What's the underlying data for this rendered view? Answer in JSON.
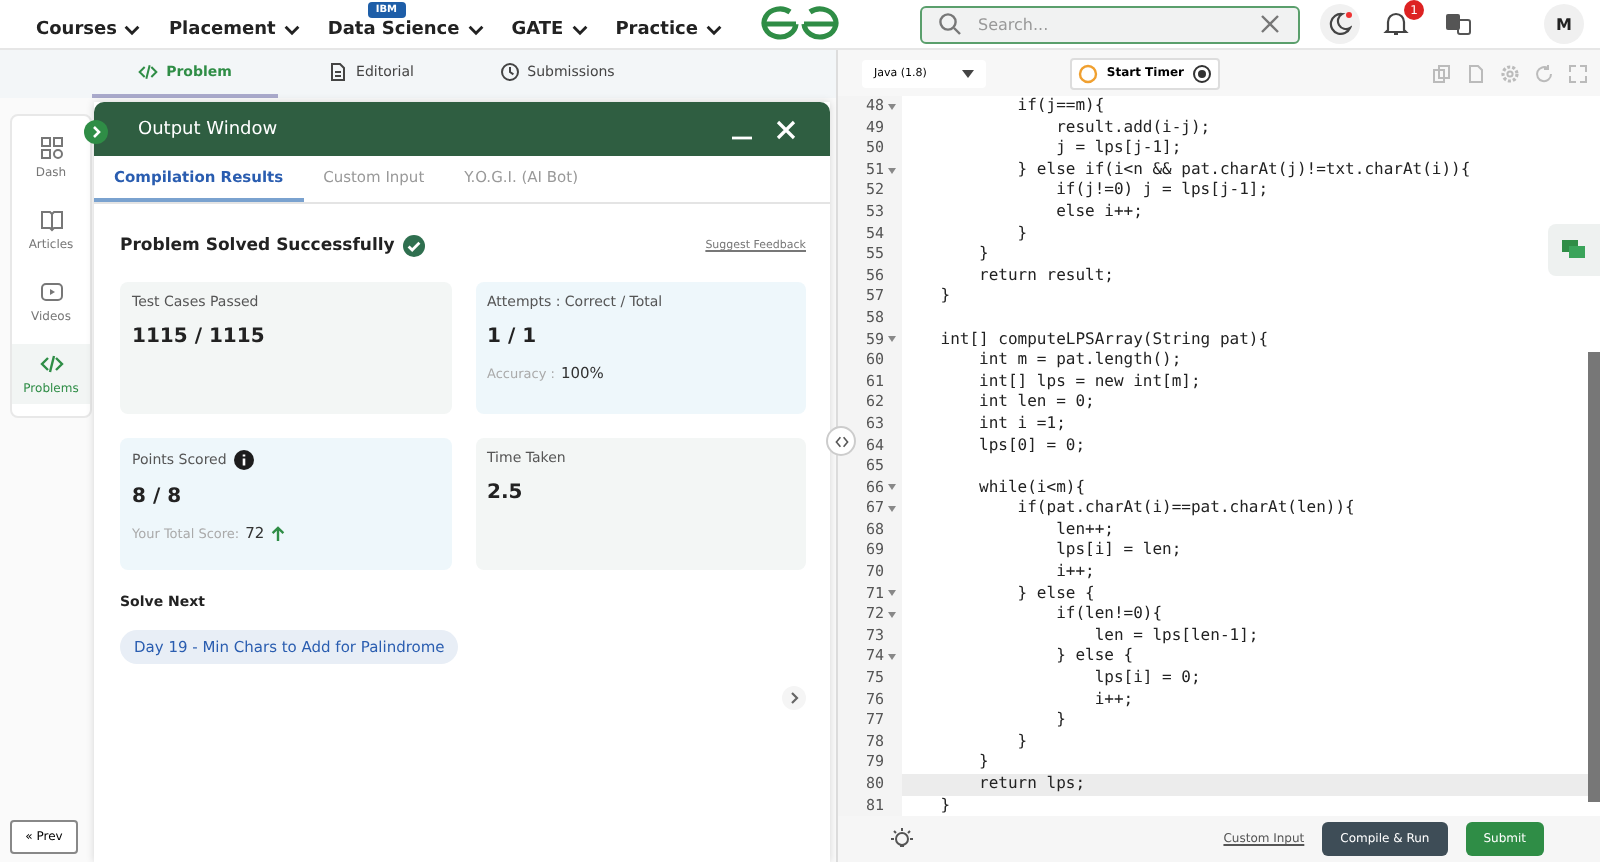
{
  "nav": {
    "items": [
      {
        "label": "Courses"
      },
      {
        "label": "Placement"
      },
      {
        "label": "Data Science",
        "badge": "IBM"
      },
      {
        "label": "GATE"
      },
      {
        "label": "Practice"
      }
    ],
    "search": {
      "placeholder": "Search..."
    },
    "notification_count": "1",
    "avatar_initial": "M"
  },
  "problem_tabs": [
    {
      "label": "Problem",
      "selected": true
    },
    {
      "label": "Editorial",
      "selected": false
    },
    {
      "label": "Submissions",
      "selected": false
    }
  ],
  "sidebar": {
    "items": [
      {
        "label": "Dash",
        "selected": false
      },
      {
        "label": "Articles",
        "selected": false
      },
      {
        "label": "Videos",
        "selected": false
      },
      {
        "label": "Problems",
        "selected": true
      }
    ],
    "prev_button": "« Prev"
  },
  "output_window": {
    "title": "Output Window",
    "tabs": [
      {
        "label": "Compilation Results",
        "selected": true
      },
      {
        "label": "Custom Input",
        "selected": false
      },
      {
        "label": "Y.O.G.I. (AI Bot)",
        "selected": false
      }
    ],
    "status": "Problem Solved Successfully",
    "feedback_link": "Suggest Feedback",
    "cards": [
      {
        "label": "Test Cases Passed",
        "value": "1115 / 1115"
      },
      {
        "label": "Attempts : Correct / Total",
        "value": "1 / 1",
        "note_label": "Accuracy :",
        "note_value": "100%"
      },
      {
        "label": "Points Scored",
        "value": "8 / 8",
        "info": true,
        "note_label": "Your Total Score:",
        "note_value": "72",
        "trend_up": true
      },
      {
        "label": "Time Taken",
        "value": "2.5"
      }
    ],
    "solve_next": {
      "heading": "Solve Next",
      "items": [
        "Day 19 - Min Chars to Add for Palindrome"
      ]
    }
  },
  "editor": {
    "language": "Java (1.8)",
    "timer_button": "Start Timer",
    "lines": [
      {
        "number": "48",
        "text": "            if(j==m){",
        "fold": true,
        "current": false
      },
      {
        "number": "49",
        "text": "                result.add(i-j);",
        "fold": false,
        "current": false
      },
      {
        "number": "50",
        "text": "                j = lps[j-1];",
        "fold": false,
        "current": false
      },
      {
        "number": "51",
        "text": "            } else if(i<n && pat.charAt(j)!=txt.charAt(i)){",
        "fold": true,
        "current": false
      },
      {
        "number": "52",
        "text": "                if(j!=0) j = lps[j-1];",
        "fold": false,
        "current": false
      },
      {
        "number": "53",
        "text": "                else i++;",
        "fold": false,
        "current": false
      },
      {
        "number": "54",
        "text": "            }",
        "fold": false,
        "current": false
      },
      {
        "number": "55",
        "text": "        }",
        "fold": false,
        "current": false
      },
      {
        "number": "56",
        "text": "        return result;",
        "fold": false,
        "current": false
      },
      {
        "number": "57",
        "text": "    }",
        "fold": false,
        "current": false
      },
      {
        "number": "58",
        "fold": false,
        "current": false
      },
      {
        "number": "59",
        "text": "    int[] computeLPSArray(String pat){",
        "fold": true,
        "current": false
      },
      {
        "number": "60",
        "text": "        int m = pat.length();",
        "fold": false,
        "current": false
      },
      {
        "number": "61",
        "text": "        int[] lps = new int[m];",
        "fold": false,
        "current": false
      },
      {
        "number": "62",
        "text": "        int len = 0;",
        "fold": false,
        "current": false
      },
      {
        "number": "63",
        "text": "        int i =1;",
        "fold": false,
        "current": false
      },
      {
        "number": "64",
        "text": "        lps[0] = 0;",
        "fold": false,
        "current": false
      },
      {
        "number": "65",
        "fold": false,
        "current": false
      },
      {
        "number": "66",
        "text": "        while(i<m){",
        "fold": true,
        "current": false
      },
      {
        "number": "67",
        "text": "            if(pat.charAt(i)==pat.charAt(len)){",
        "fold": true,
        "current": false
      },
      {
        "number": "68",
        "text": "                len++;",
        "fold": false,
        "current": false
      },
      {
        "number": "69",
        "text": "                lps[i] = len;",
        "fold": false,
        "current": false
      },
      {
        "number": "70",
        "text": "                i++;",
        "fold": false,
        "current": false
      },
      {
        "number": "71",
        "text": "            } else {",
        "fold": true,
        "current": false
      },
      {
        "number": "72",
        "text": "                if(len!=0){",
        "fold": true,
        "current": false
      },
      {
        "number": "73",
        "text": "                    len = lps[len-1];",
        "fold": false,
        "current": false
      },
      {
        "number": "74",
        "text": "                } else {",
        "fold": true,
        "current": false
      },
      {
        "number": "75",
        "text": "                    lps[i] = 0;",
        "fold": false,
        "current": false
      },
      {
        "number": "76",
        "text": "                    i++;",
        "fold": false,
        "current": false
      },
      {
        "number": "77",
        "text": "                }",
        "fold": false,
        "current": false
      },
      {
        "number": "78",
        "text": "            }",
        "fold": false,
        "current": false
      },
      {
        "number": "79",
        "text": "        }",
        "fold": false,
        "current": false
      },
      {
        "number": "80",
        "text": "        return lps;",
        "fold": false,
        "current": true
      },
      {
        "number": "81",
        "text": "    }",
        "fold": false,
        "current": false
      }
    ],
    "custom_input_link": "Custom Input",
    "compile_button": "Compile & Run",
    "submit_button": "Submit"
  }
}
